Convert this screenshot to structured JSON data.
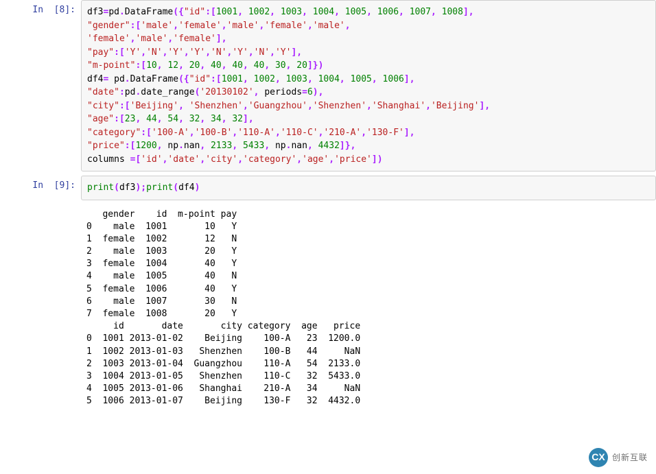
{
  "cells": [
    {
      "prompt": "In  [8]:",
      "type": "code",
      "tokens": [
        [
          "name",
          "df3"
        ],
        [
          "op",
          "="
        ],
        [
          "name",
          "pd"
        ],
        [
          "op",
          "."
        ],
        [
          "name",
          "DataFrame"
        ],
        [
          "op",
          "("
        ],
        [
          "op",
          "{"
        ],
        [
          "str",
          "\"id\""
        ],
        [
          "op",
          ":"
        ],
        [
          "op",
          "["
        ],
        [
          "num",
          "1001"
        ],
        [
          "op",
          ","
        ],
        [
          "tok",
          " "
        ],
        [
          "num",
          "1002"
        ],
        [
          "op",
          ","
        ],
        [
          "tok",
          " "
        ],
        [
          "num",
          "1003"
        ],
        [
          "op",
          ","
        ],
        [
          "tok",
          " "
        ],
        [
          "num",
          "1004"
        ],
        [
          "op",
          ","
        ],
        [
          "tok",
          " "
        ],
        [
          "num",
          "1005"
        ],
        [
          "op",
          ","
        ],
        [
          "tok",
          " "
        ],
        [
          "num",
          "1006"
        ],
        [
          "op",
          ","
        ],
        [
          "tok",
          " "
        ],
        [
          "num",
          "1007"
        ],
        [
          "op",
          ","
        ],
        [
          "tok",
          " "
        ],
        [
          "num",
          "1008"
        ],
        [
          "op",
          "]"
        ],
        [
          "op",
          ","
        ],
        [
          "tok",
          "\n"
        ],
        [
          "str",
          "\"gender\""
        ],
        [
          "op",
          ":"
        ],
        [
          "op",
          "["
        ],
        [
          "str",
          "'male'"
        ],
        [
          "op",
          ","
        ],
        [
          "str",
          "'female'"
        ],
        [
          "op",
          ","
        ],
        [
          "str",
          "'male'"
        ],
        [
          "op",
          ","
        ],
        [
          "str",
          "'female'"
        ],
        [
          "op",
          ","
        ],
        [
          "str",
          "'male'"
        ],
        [
          "op",
          ","
        ],
        [
          "tok",
          "\n"
        ],
        [
          "str",
          "'female'"
        ],
        [
          "op",
          ","
        ],
        [
          "str",
          "'male'"
        ],
        [
          "op",
          ","
        ],
        [
          "str",
          "'female'"
        ],
        [
          "op",
          "]"
        ],
        [
          "op",
          ","
        ],
        [
          "tok",
          "\n"
        ],
        [
          "str",
          "\"pay\""
        ],
        [
          "op",
          ":"
        ],
        [
          "op",
          "["
        ],
        [
          "str",
          "'Y'"
        ],
        [
          "op",
          ","
        ],
        [
          "str",
          "'N'"
        ],
        [
          "op",
          ","
        ],
        [
          "str",
          "'Y'"
        ],
        [
          "op",
          ","
        ],
        [
          "str",
          "'Y'"
        ],
        [
          "op",
          ","
        ],
        [
          "str",
          "'N'"
        ],
        [
          "op",
          ","
        ],
        [
          "str",
          "'Y'"
        ],
        [
          "op",
          ","
        ],
        [
          "str",
          "'N'"
        ],
        [
          "op",
          ","
        ],
        [
          "str",
          "'Y'"
        ],
        [
          "op",
          "]"
        ],
        [
          "op",
          ","
        ],
        [
          "tok",
          "\n"
        ],
        [
          "str",
          "\"m-point\""
        ],
        [
          "op",
          ":"
        ],
        [
          "op",
          "["
        ],
        [
          "num",
          "10"
        ],
        [
          "op",
          ","
        ],
        [
          "tok",
          " "
        ],
        [
          "num",
          "12"
        ],
        [
          "op",
          ","
        ],
        [
          "tok",
          " "
        ],
        [
          "num",
          "20"
        ],
        [
          "op",
          ","
        ],
        [
          "tok",
          " "
        ],
        [
          "num",
          "40"
        ],
        [
          "op",
          ","
        ],
        [
          "tok",
          " "
        ],
        [
          "num",
          "40"
        ],
        [
          "op",
          ","
        ],
        [
          "tok",
          " "
        ],
        [
          "num",
          "40"
        ],
        [
          "op",
          ","
        ],
        [
          "tok",
          " "
        ],
        [
          "num",
          "30"
        ],
        [
          "op",
          ","
        ],
        [
          "tok",
          " "
        ],
        [
          "num",
          "20"
        ],
        [
          "op",
          "]"
        ],
        [
          "op",
          "}"
        ],
        [
          "op",
          ")"
        ],
        [
          "tok",
          "\n"
        ],
        [
          "name",
          "df4"
        ],
        [
          "op",
          "="
        ],
        [
          "tok",
          " "
        ],
        [
          "name",
          "pd"
        ],
        [
          "op",
          "."
        ],
        [
          "name",
          "DataFrame"
        ],
        [
          "op",
          "("
        ],
        [
          "op",
          "{"
        ],
        [
          "str",
          "\"id\""
        ],
        [
          "op",
          ":"
        ],
        [
          "op",
          "["
        ],
        [
          "num",
          "1001"
        ],
        [
          "op",
          ","
        ],
        [
          "tok",
          " "
        ],
        [
          "num",
          "1002"
        ],
        [
          "op",
          ","
        ],
        [
          "tok",
          " "
        ],
        [
          "num",
          "1003"
        ],
        [
          "op",
          ","
        ],
        [
          "tok",
          " "
        ],
        [
          "num",
          "1004"
        ],
        [
          "op",
          ","
        ],
        [
          "tok",
          " "
        ],
        [
          "num",
          "1005"
        ],
        [
          "op",
          ","
        ],
        [
          "tok",
          " "
        ],
        [
          "num",
          "1006"
        ],
        [
          "op",
          "]"
        ],
        [
          "op",
          ","
        ],
        [
          "tok",
          "\n"
        ],
        [
          "str",
          "\"date\""
        ],
        [
          "op",
          ":"
        ],
        [
          "name",
          "pd"
        ],
        [
          "op",
          "."
        ],
        [
          "name",
          "date_range"
        ],
        [
          "op",
          "("
        ],
        [
          "str",
          "'20130102'"
        ],
        [
          "op",
          ","
        ],
        [
          "tok",
          " "
        ],
        [
          "name",
          "periods"
        ],
        [
          "op",
          "="
        ],
        [
          "num",
          "6"
        ],
        [
          "op",
          ")"
        ],
        [
          "op",
          ","
        ],
        [
          "tok",
          "\n"
        ],
        [
          "str",
          "\"city\""
        ],
        [
          "op",
          ":"
        ],
        [
          "op",
          "["
        ],
        [
          "str",
          "'Beijing'"
        ],
        [
          "op",
          ","
        ],
        [
          "tok",
          " "
        ],
        [
          "str",
          "'Shenzhen'"
        ],
        [
          "op",
          ","
        ],
        [
          "str",
          "'Guangzhou'"
        ],
        [
          "op",
          ","
        ],
        [
          "str",
          "'Shenzhen'"
        ],
        [
          "op",
          ","
        ],
        [
          "str",
          "'Shanghai'"
        ],
        [
          "op",
          ","
        ],
        [
          "str",
          "'Beijing'"
        ],
        [
          "op",
          "]"
        ],
        [
          "op",
          ","
        ],
        [
          "tok",
          "\n"
        ],
        [
          "str",
          "\"age\""
        ],
        [
          "op",
          ":"
        ],
        [
          "op",
          "["
        ],
        [
          "num",
          "23"
        ],
        [
          "op",
          ","
        ],
        [
          "tok",
          " "
        ],
        [
          "num",
          "44"
        ],
        [
          "op",
          ","
        ],
        [
          "tok",
          " "
        ],
        [
          "num",
          "54"
        ],
        [
          "op",
          ","
        ],
        [
          "tok",
          " "
        ],
        [
          "num",
          "32"
        ],
        [
          "op",
          ","
        ],
        [
          "tok",
          " "
        ],
        [
          "num",
          "34"
        ],
        [
          "op",
          ","
        ],
        [
          "tok",
          " "
        ],
        [
          "num",
          "32"
        ],
        [
          "op",
          "]"
        ],
        [
          "op",
          ","
        ],
        [
          "tok",
          "\n"
        ],
        [
          "str",
          "\"category\""
        ],
        [
          "op",
          ":"
        ],
        [
          "op",
          "["
        ],
        [
          "str",
          "'100-A'"
        ],
        [
          "op",
          ","
        ],
        [
          "str",
          "'100-B'"
        ],
        [
          "op",
          ","
        ],
        [
          "str",
          "'110-A'"
        ],
        [
          "op",
          ","
        ],
        [
          "str",
          "'110-C'"
        ],
        [
          "op",
          ","
        ],
        [
          "str",
          "'210-A'"
        ],
        [
          "op",
          ","
        ],
        [
          "str",
          "'130-F'"
        ],
        [
          "op",
          "]"
        ],
        [
          "op",
          ","
        ],
        [
          "tok",
          "\n"
        ],
        [
          "str",
          "\"price\""
        ],
        [
          "op",
          ":"
        ],
        [
          "op",
          "["
        ],
        [
          "num",
          "1200"
        ],
        [
          "op",
          ","
        ],
        [
          "tok",
          " "
        ],
        [
          "name",
          "np"
        ],
        [
          "op",
          "."
        ],
        [
          "name",
          "nan"
        ],
        [
          "op",
          ","
        ],
        [
          "tok",
          " "
        ],
        [
          "num",
          "2133"
        ],
        [
          "op",
          ","
        ],
        [
          "tok",
          " "
        ],
        [
          "num",
          "5433"
        ],
        [
          "op",
          ","
        ],
        [
          "tok",
          " "
        ],
        [
          "name",
          "np"
        ],
        [
          "op",
          "."
        ],
        [
          "name",
          "nan"
        ],
        [
          "op",
          ","
        ],
        [
          "tok",
          " "
        ],
        [
          "num",
          "4432"
        ],
        [
          "op",
          "]"
        ],
        [
          "op",
          "}"
        ],
        [
          "op",
          ","
        ],
        [
          "tok",
          "\n"
        ],
        [
          "name",
          "columns "
        ],
        [
          "op",
          "="
        ],
        [
          "op",
          "["
        ],
        [
          "str",
          "'id'"
        ],
        [
          "op",
          ","
        ],
        [
          "str",
          "'date'"
        ],
        [
          "op",
          ","
        ],
        [
          "str",
          "'city'"
        ],
        [
          "op",
          ","
        ],
        [
          "str",
          "'category'"
        ],
        [
          "op",
          ","
        ],
        [
          "str",
          "'age'"
        ],
        [
          "op",
          ","
        ],
        [
          "str",
          "'price'"
        ],
        [
          "op",
          "]"
        ],
        [
          "op",
          ")"
        ]
      ]
    },
    {
      "prompt": "In  [9]:",
      "type": "code",
      "tokens": [
        [
          "builtin",
          "print"
        ],
        [
          "op",
          "("
        ],
        [
          "name",
          "df3"
        ],
        [
          "op",
          ")"
        ],
        [
          "op",
          ";"
        ],
        [
          "builtin",
          "print"
        ],
        [
          "op",
          "("
        ],
        [
          "name",
          "df4"
        ],
        [
          "op",
          ")"
        ]
      ],
      "output": "   gender    id  m-point pay\n0    male  1001       10   Y\n1  female  1002       12   N\n2    male  1003       20   Y\n3  female  1004       40   Y\n4    male  1005       40   N\n5  female  1006       40   Y\n6    male  1007       30   N\n7  female  1008       20   Y\n     id       date       city category  age   price\n0  1001 2013-01-02    Beijing    100-A   23  1200.0\n1  1002 2013-01-03   Shenzhen    100-B   44     NaN\n2  1003 2013-01-04  Guangzhou    110-A   54  2133.0\n3  1004 2013-01-05   Shenzhen    110-C   32  5433.0\n4  1005 2013-01-06   Shanghai    210-A   34     NaN\n5  1006 2013-01-07    Beijing    130-F   32  4432.0"
    }
  ],
  "watermark": {
    "icon_text": "CX",
    "label": "创新互联"
  }
}
